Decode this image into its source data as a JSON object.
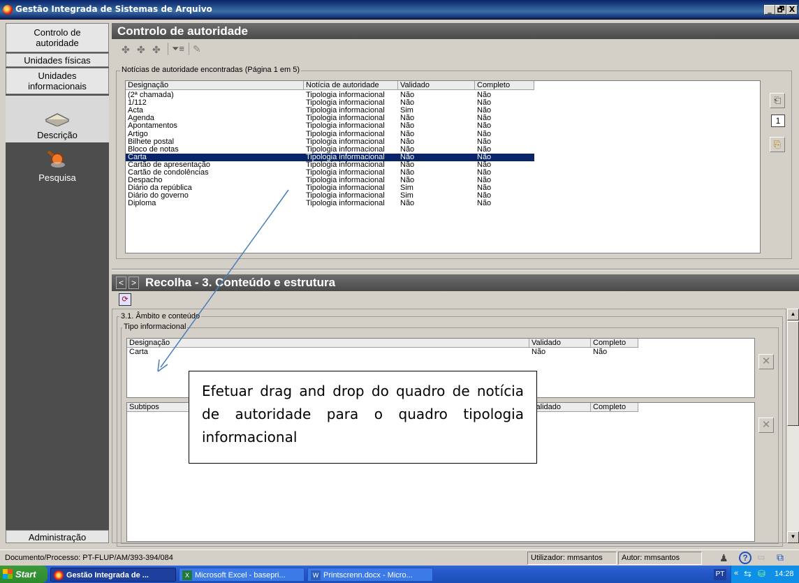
{
  "window": {
    "title": "Gestão Integrada de Sistemas de Arquivo",
    "controls": [
      "_",
      "🗗",
      "X"
    ]
  },
  "sidebar": {
    "tabs": [
      "Controlo de\nautoridade",
      "Unidades físicas",
      "Unidades\ninformacionais"
    ],
    "nav": [
      {
        "label": "Descrição",
        "icon": "book-icon"
      },
      {
        "label": "Pesquisa",
        "icon": "magnifier-icon"
      }
    ],
    "bottom": "Administração"
  },
  "authority": {
    "title": "Controlo de autoridade",
    "group_label": "Notícias de autoridade encontradas (Página 1 em 5)",
    "columns": [
      "Designação",
      "Notícia de autoridade",
      "Validado",
      "Completo"
    ],
    "rows": [
      [
        "(2ª chamada)",
        "Tipologia informacional",
        "Não",
        "Não"
      ],
      [
        "1/112",
        "Tipologia informacional",
        "Não",
        "Não"
      ],
      [
        "Acta",
        "Tipologia informacional",
        "Sim",
        "Não"
      ],
      [
        "Agenda",
        "Tipologia informacional",
        "Não",
        "Não"
      ],
      [
        "Apontamentos",
        "Tipologia informacional",
        "Não",
        "Não"
      ],
      [
        "Artigo",
        "Tipologia informacional",
        "Não",
        "Não"
      ],
      [
        "Bilhete postal",
        "Tipologia informacional",
        "Não",
        "Não"
      ],
      [
        "Bloco de notas",
        "Tipologia informacional",
        "Não",
        "Não"
      ],
      [
        "Carta",
        "Tipologia informacional",
        "Não",
        "Não"
      ],
      [
        "Cartão de apresentação",
        "Tipologia informacional",
        "Não",
        "Não"
      ],
      [
        "Cartão de condolências",
        "Tipologia informacional",
        "Não",
        "Não"
      ],
      [
        "Despacho",
        "Tipologia informacional",
        "Não",
        "Não"
      ],
      [
        "Diário da república",
        "Tipologia informacional",
        "Sim",
        "Não"
      ],
      [
        "Diário do governo",
        "Tipologia informacional",
        "Sim",
        "Não"
      ],
      [
        "Diploma",
        "Tipologia informacional",
        "Não",
        "Não"
      ]
    ],
    "selected_row": 8,
    "page_value": "1"
  },
  "collect": {
    "title": "Recolha - 3. Conteúdo e estrutura",
    "nav_prev": "<",
    "nav_next": ">",
    "section_label": "3.1. Âmbito e conteúdo",
    "type_group_label": "Tipo informacional",
    "type_columns": [
      "Designação",
      "Validado",
      "Completo"
    ],
    "type_rows": [
      [
        "Carta",
        "Não",
        "Não"
      ]
    ],
    "subtype_columns": [
      "Subtipos",
      "Validado",
      "Completo"
    ]
  },
  "callout": {
    "text": "Efetuar drag and drop do quadro de notícia de autoridade para o quadro tipologia informacional"
  },
  "status": {
    "document": "Documento/Processo: PT-FLUP/AM/393-394/084",
    "user": "Utilizador: mmsantos",
    "author": "Autor: mmsantos"
  },
  "taskbar": {
    "start": "start",
    "tasks": [
      "Gestão Integrada de ...",
      "Microsoft Excel - basepri...",
      "Printscrenn.docx - Micro..."
    ],
    "lang": "PT",
    "clock": "14:28"
  },
  "colors": {
    "selection": "#0a246a",
    "header": "#5a5a5a",
    "sidebar": "#4d4d4d",
    "taskbar": "#245edb"
  }
}
